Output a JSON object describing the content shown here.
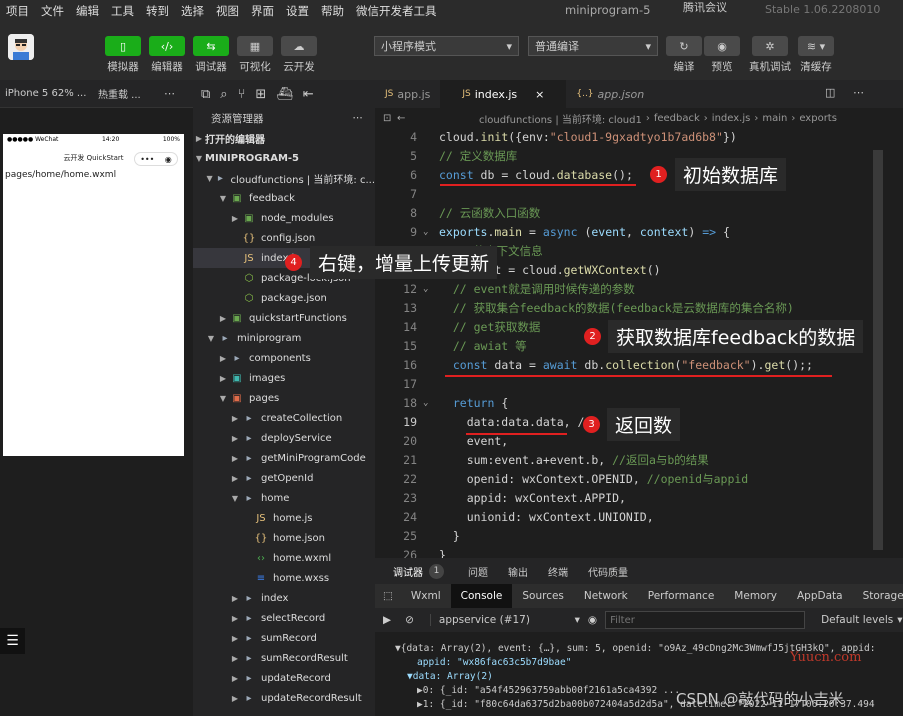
{
  "menubar": {
    "items": [
      "项目",
      "文件",
      "编辑",
      "工具",
      "转到",
      "选择",
      "视图",
      "界面",
      "设置",
      "帮助",
      "微信开发者工具"
    ],
    "window_title": "miniprogram-5",
    "version": "Stable 1.06.2208010",
    "meeting": "腾讯会议"
  },
  "toolbar": {
    "simulator": "模拟器",
    "editor": "编辑器",
    "debugger": "调试器",
    "visual": "可视化",
    "cloud": "云开发",
    "mode_select": "小程序模式",
    "compile_select": "普通编译",
    "compile": "编译",
    "preview": "预览",
    "real_debug": "真机调试",
    "clear_cache": "清缓存"
  },
  "simbar": {
    "device": "iPhone 5 62% ...",
    "hot_reload": "热重载 ...",
    "more": "⋯"
  },
  "simulator": {
    "carrier": "●●●●● WeChat",
    "time": "14:20",
    "battery": "100%",
    "title": "云开发 QuickStart",
    "page": "pages/home/home.wxml"
  },
  "explorer": {
    "title": "资源管理器",
    "more": "⋯",
    "open_editors": "打开的编辑器",
    "project": "MINIPROGRAM-5",
    "tree": [
      {
        "label": "cloudfunctions | 当前环境: c...",
        "icon": "folder",
        "indent": 1,
        "open": true
      },
      {
        "label": "feedback",
        "icon": "cloud-folder",
        "indent": 2,
        "open": true
      },
      {
        "label": "node_modules",
        "icon": "cloud-folder",
        "indent": 3,
        "open": false
      },
      {
        "label": "config.json",
        "icon": "json",
        "indent": 3
      },
      {
        "label": "index.js",
        "icon": "js",
        "indent": 3,
        "selected": true
      },
      {
        "label": "package-lock.json",
        "icon": "npm",
        "indent": 3
      },
      {
        "label": "package.json",
        "icon": "npm",
        "indent": 3
      },
      {
        "label": "quickstartFunctions",
        "icon": "cloud-folder",
        "indent": 2,
        "open": false
      },
      {
        "label": "miniprogram",
        "icon": "folder",
        "indent": 1,
        "open": true
      },
      {
        "label": "components",
        "icon": "folder",
        "indent": 2,
        "open": false
      },
      {
        "label": "images",
        "icon": "img-folder",
        "indent": 2,
        "open": false
      },
      {
        "label": "pages",
        "icon": "folder-red",
        "indent": 2,
        "open": true
      },
      {
        "label": "createCollection",
        "icon": "folder",
        "indent": 3,
        "open": false
      },
      {
        "label": "deployService",
        "icon": "folder",
        "indent": 3,
        "open": false
      },
      {
        "label": "getMiniProgramCode",
        "icon": "folder",
        "indent": 3,
        "open": false
      },
      {
        "label": "getOpenId",
        "icon": "folder",
        "indent": 3,
        "open": false
      },
      {
        "label": "home",
        "icon": "folder",
        "indent": 3,
        "open": true
      },
      {
        "label": "home.js",
        "icon": "js",
        "indent": 4
      },
      {
        "label": "home.json",
        "icon": "json",
        "indent": 4
      },
      {
        "label": "home.wxml",
        "icon": "wxml",
        "indent": 4
      },
      {
        "label": "home.wxss",
        "icon": "wxss",
        "indent": 4
      },
      {
        "label": "index",
        "icon": "folder",
        "indent": 3,
        "open": false
      },
      {
        "label": "selectRecord",
        "icon": "folder",
        "indent": 3,
        "open": false
      },
      {
        "label": "sumRecord",
        "icon": "folder",
        "indent": 3,
        "open": false
      },
      {
        "label": "sumRecordResult",
        "icon": "folder",
        "indent": 3,
        "open": false
      },
      {
        "label": "updateRecord",
        "icon": "folder",
        "indent": 3,
        "open": false
      },
      {
        "label": "updateRecordResult",
        "icon": "folder",
        "indent": 3,
        "open": false
      }
    ]
  },
  "tabs": [
    {
      "label": "app.js",
      "icon": "JS"
    },
    {
      "label": "index.js",
      "icon": "JS",
      "active": true
    },
    {
      "label": "app.json",
      "icon": "{..}"
    }
  ],
  "breadcrumb": [
    "cloudfunctions | 当前环境: cloud1",
    "feedback",
    "index.js",
    "main",
    "exports"
  ],
  "code": [
    {
      "n": "4",
      "html": "<span class='p'>cloud.</span><span class='f'>init</span><span class='p'>({env:</span><span class='s'>\"cloud1-9gxadtyo1b7ad6b8\"</span><span class='p'>})</span>"
    },
    {
      "n": "5",
      "html": "<span class='c'>// 定义数据库</span>"
    },
    {
      "n": "6",
      "html": "<span class='k'>const</span><span class='p'> db = cloud.</span><span class='f'>database</span><span class='p'>();</span>"
    },
    {
      "n": "7",
      "html": ""
    },
    {
      "n": "8",
      "html": "<span class='c'>// 云函数入口函数</span>"
    },
    {
      "n": "9",
      "html": "<span class='v'>exports</span><span class='p'>.</span><span class='f'>main</span><span class='p'> = </span><span class='k'>async</span><span class='p'> (</span><span class='v'>event</span><span class='p'>, </span><span class='v'>context</span><span class='p'>) </span><span class='k'>=&gt;</span><span class='p'> {</span>"
    },
    {
      "n": "10",
      "html": "<span class='c'>  // 的上下文信息</span>"
    },
    {
      "n": "11",
      "html": "<span class='p'>  context = cloud.</span><span class='f'>getWXContext</span><span class='p'>()</span>"
    },
    {
      "n": "12",
      "html": "<span class='c'>  // event就是调用时候传递的参数</span>"
    },
    {
      "n": "13",
      "html": "<span class='c'>  // 获取集合feedback的数据(feedback是云数据库的集合名称)</span>"
    },
    {
      "n": "14",
      "html": "<span class='c'>  // get获取数据</span>"
    },
    {
      "n": "15",
      "html": "<span class='c'>  // awiat 等</span>"
    },
    {
      "n": "16",
      "html": "<span class='k'>  const</span><span class='p'> data = </span><span class='k'>await</span><span class='p'> db.</span><span class='f'>collection</span><span class='p'>(</span><span class='s'>\"feedback\"</span><span class='p'>).</span><span class='f'>get</span><span class='p'>();;</span>"
    },
    {
      "n": "17",
      "html": ""
    },
    {
      "n": "18",
      "html": "<span class='k'>  return</span><span class='p'> {</span>"
    },
    {
      "n": "19",
      "html": "<span class='p'>    data:data.data, /</span>"
    },
    {
      "n": "20",
      "html": "<span class='p'>    event,</span>"
    },
    {
      "n": "21",
      "html": "<span class='p'>    sum:event.a+event.b, </span><span class='c'>//返回a与b的结果</span>"
    },
    {
      "n": "22",
      "html": "<span class='p'>    openid: wxContext.OPENID, </span><span class='c'>//openid与appid</span>"
    },
    {
      "n": "23",
      "html": "<span class='p'>    appid: wxContext.APPID,</span>"
    },
    {
      "n": "24",
      "html": "<span class='p'>    unionid: wxContext.UNIONID,</span>"
    },
    {
      "n": "25",
      "html": "<span class='p'>  }</span>"
    },
    {
      "n": "26",
      "html": "<span class='p'>}</span>"
    }
  ],
  "callouts": [
    {
      "num": "1",
      "text": "初始数据库"
    },
    {
      "num": "2",
      "text": "获取数据库feedback的数据"
    },
    {
      "num": "3",
      "text": "返回数"
    },
    {
      "num": "4",
      "text": "右键，增量上传更新"
    }
  ],
  "devtools": {
    "tabs": [
      "调试器",
      "问题",
      "输出",
      "终端",
      "代码质量"
    ],
    "badge": "1",
    "console_tabs": [
      "Wxml",
      "Console",
      "Sources",
      "Network",
      "Performance",
      "Memory",
      "AppData",
      "Storage"
    ],
    "context": "appservice (#17)",
    "filter_placeholder": "Filter",
    "levels": "Default levels"
  },
  "console": {
    "l1": "▼{data: Array(2), event: {…}, sum: 5, openid: \"o9Az_49cDng2Mc3WmwfJ5jtGH3kQ\", appid:",
    "l2": "appid: \"wx86fac63c5b7d9bae\"",
    "l3": "▼data: Array(2)",
    "l4": "▶0: {_id: \"a54f452963759abb00f2161a5ca4392 ...",
    "l5": "▶1: {_id: \"f80c64da6375d2ba00b072404a5d2d5a\", datetime: \"2022-11-17T06:20:37.494"
  },
  "watermark": {
    "csdn": "CSDN @敲代码的小吉米",
    "site": "Yuucn.com"
  }
}
